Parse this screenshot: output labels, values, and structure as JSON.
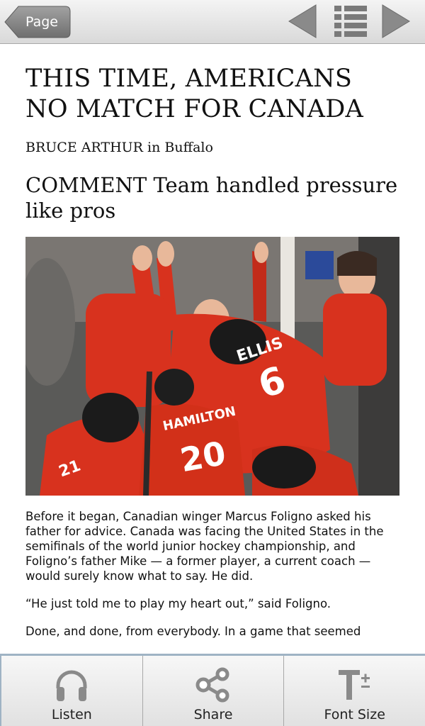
{
  "toolbar": {
    "back_label": "Page",
    "icons": [
      "back-arrow-icon",
      "previous-triangle-icon",
      "table-of-contents-icon",
      "next-triangle-icon"
    ]
  },
  "article": {
    "headline": "THIS TIME, AMERICANS NO MATCH FOR CANADA",
    "byline": "BRUCE ARTHUR in Buffalo",
    "subhead": "COMMENT Team handled pressure like pros",
    "photo": {
      "jersey_numbers": [
        "6",
        "20",
        "21"
      ],
      "jersey_names": [
        "ELLIS",
        "HAMILTON"
      ]
    },
    "paragraphs": [
      "Before it began, Canadian winger Marcus Foligno asked his father for advice. Canada was facing the United States in the semifinals of the world junior hockey championship, and Foligno’s father Mike — a former player, a current coach — would surely know what to say. He did.",
      "“He just told me to play my heart out,” said Foligno.",
      "Done, and done, from everybody. In a game that seemed"
    ]
  },
  "actions": [
    {
      "label": "Listen",
      "icon": "headphones-icon"
    },
    {
      "label": "Share",
      "icon": "share-icon"
    },
    {
      "label": "Font Size",
      "icon": "font-size-icon"
    }
  ],
  "colors": {
    "toolbar_button": "#8a8a8a",
    "jersey_red": "#d8321e",
    "bottom_accent": "#9fb3c4"
  }
}
